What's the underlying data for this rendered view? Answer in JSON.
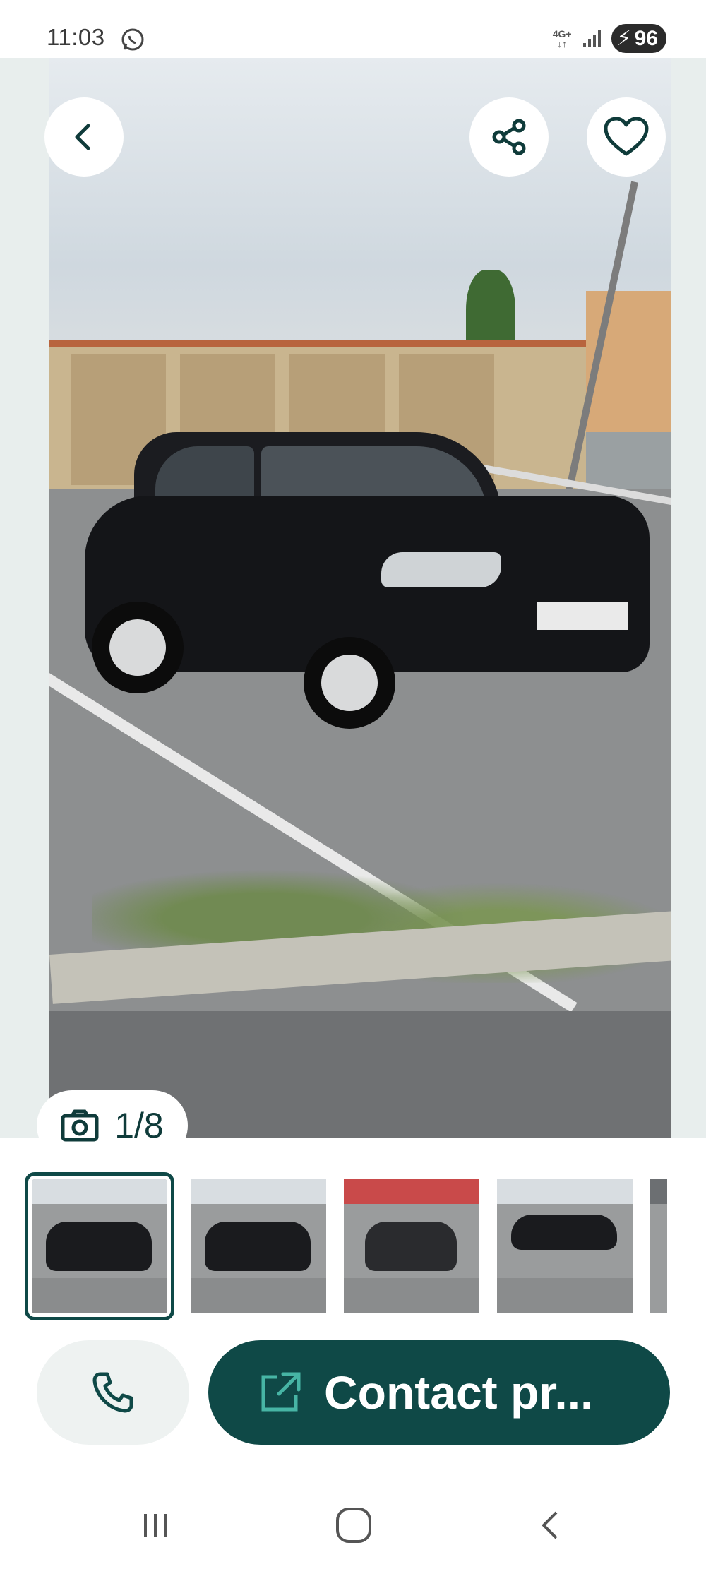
{
  "status_bar": {
    "time": "11:03",
    "network": "4G+",
    "battery": "96",
    "icons": [
      "whatsapp-icon",
      "signal-icon",
      "battery-charging-icon"
    ]
  },
  "gallery": {
    "counter": "1/8",
    "icons": [
      "back-arrow-icon",
      "share-icon",
      "heart-icon",
      "camera-icon"
    ]
  },
  "thumbnails": [
    {
      "label": "",
      "selected": true
    },
    {
      "label": "",
      "selected": false
    },
    {
      "label": "",
      "selected": false
    },
    {
      "label": "",
      "selected": false
    },
    {
      "label": "",
      "selected": false
    }
  ],
  "actions": {
    "call_icon": "phone-icon",
    "contact_icon": "external-link-icon",
    "contact_label": "Contact pr..."
  },
  "navbar": {
    "icons": [
      "recent-apps-icon",
      "home-icon",
      "back-icon"
    ]
  },
  "colors": {
    "primary": "#0f4947",
    "overlay_button": "#ffffff",
    "secondary_button": "#eef2f1"
  }
}
